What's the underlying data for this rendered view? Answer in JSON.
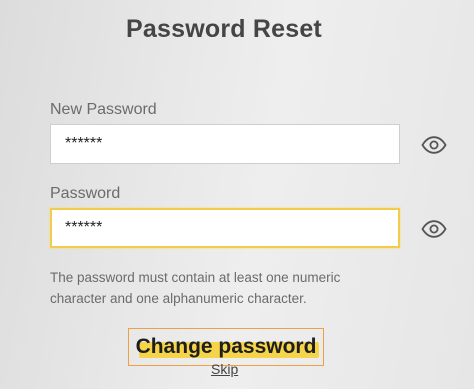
{
  "header": {
    "title": "Password Reset"
  },
  "form": {
    "new_password": {
      "label": "New Password",
      "value": "******",
      "toggle_icon": "eye-icon"
    },
    "password": {
      "label": "Password",
      "value": "******",
      "toggle_icon": "eye-icon"
    },
    "hint": "The password must contain at least one numeric character and one alphanumeric character."
  },
  "actions": {
    "change_label": "Change password",
    "skip_label": "Skip"
  },
  "colors": {
    "focus_border": "#f2cb4f",
    "button_highlight": "#f6d44a",
    "button_border": "#f0a040"
  }
}
